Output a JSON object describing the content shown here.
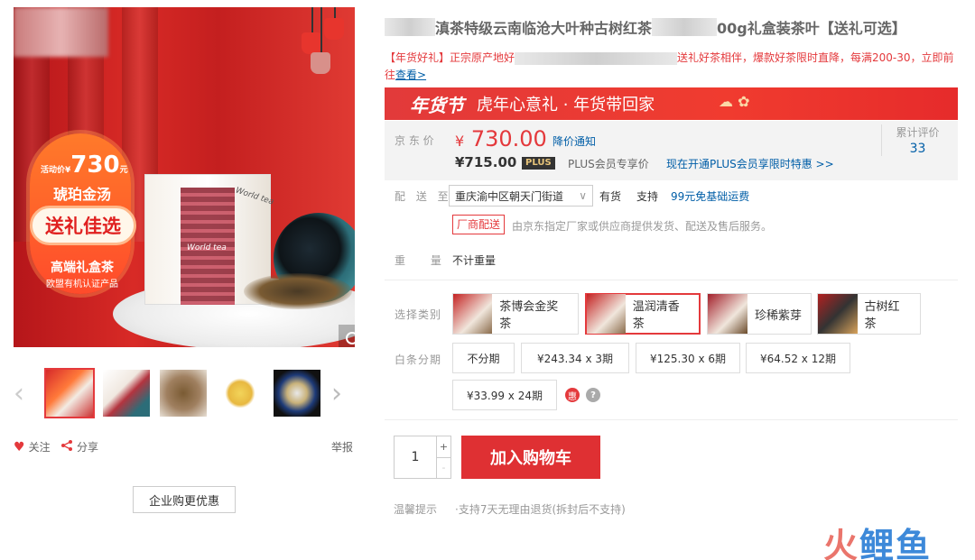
{
  "gallery": {
    "badge": {
      "price_prefix": "活动价",
      "price_symbol": "¥",
      "price": "730",
      "price_unit": "元",
      "name": "琥珀金汤",
      "pill": "送礼佳选",
      "sub1": "高端礼盒茶",
      "sub2": "欧盟有机认证产品"
    },
    "box_text": "World tea",
    "box_text2": "World tea",
    "zoom_icon": "magnifier-icon",
    "thumbs_count": 5,
    "actions": {
      "follow": "关注",
      "share": "分享",
      "report": "举报"
    },
    "biz_button": "企业购更优惠"
  },
  "product": {
    "title_mid": "滇茶特级云南临沧大叶种古树红茶",
    "title_end": "00g礼盒装茶叶【送礼可选】",
    "promo_start": "【年货好礼】正宗原产地好",
    "promo_mid": "送礼好茶相伴，爆款好茶限时直降，每满200-30，立即前往",
    "promo_link": "查看>",
    "banner_logo": "年货节",
    "banner_slogan": "虎年心意礼 · 年货带回家",
    "price_label": "京 东 价",
    "price_symbol": "¥",
    "price": "730.00",
    "price_notice": "降价通知",
    "plus_price": "¥715.00",
    "plus_tag": "PLUS",
    "plus_text": "PLUS会员专享价",
    "plus_link": "现在开通PLUS会员享限时特惠 >>",
    "review_label": "累计评价",
    "review_count": "33",
    "ship_label": "配 送 至",
    "address": "重庆渝中区朝天门街道",
    "stock": "有货",
    "support": "支持",
    "freeship": "99元免基础运费",
    "vendor_tag": "厂商配送",
    "vendor_desc": "由京东指定厂家或供应商提供发货、配送及售后服务。",
    "weight_label": "重 量",
    "weight_value": "不计重量",
    "variant_label": "选择类别",
    "variants": [
      {
        "label": "茶博会金奖茶"
      },
      {
        "label": "温润清香茶"
      },
      {
        "label": "珍稀紫芽"
      },
      {
        "label": "古树红茶"
      }
    ],
    "installment_label": "白条分期",
    "installments": [
      {
        "label": "不分期"
      },
      {
        "label": "¥243.34 x 3期"
      },
      {
        "label": "¥125.30 x 6期"
      },
      {
        "label": "¥64.52 x 12期"
      },
      {
        "label": "¥33.99 x 24期"
      }
    ],
    "hui_icon": "惠",
    "help_icon": "?",
    "quantity": "1",
    "qty_plus": "+",
    "qty_minus": "-",
    "add_cart": "加入购物车",
    "tips_label": "温馨提示",
    "tips_text": "·支持7天无理由退货(拆封后不支持)"
  },
  "watermark": {
    "part1": "火",
    "part2": "鲤鱼"
  }
}
